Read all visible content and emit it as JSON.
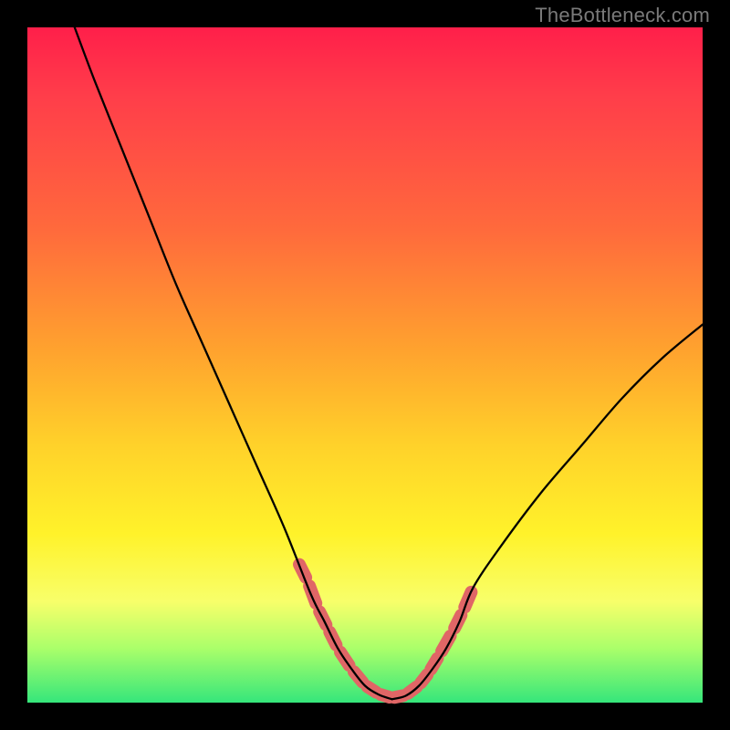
{
  "watermark": "TheBottleneck.com",
  "colors": {
    "frame_bg": "#000000",
    "gradient_top": "#ff1f4a",
    "gradient_bottom": "#35e67b",
    "curve": "#000000",
    "marker": "#e06666"
  },
  "chart_data": {
    "type": "line",
    "title": "",
    "xlabel": "",
    "ylabel": "",
    "xlim": [
      0,
      100
    ],
    "ylim": [
      0,
      100
    ],
    "grid": false,
    "legend": false,
    "annotations": [
      "TheBottleneck.com"
    ],
    "curve_left": {
      "x": [
        7,
        10,
        14,
        18,
        22,
        26,
        30,
        34,
        38,
        42,
        44,
        46,
        48,
        50,
        52,
        54
      ],
      "y": [
        100,
        92,
        82,
        72,
        62,
        53,
        44,
        35,
        26,
        16,
        12,
        8,
        5,
        2.5,
        1.2,
        0.5
      ]
    },
    "curve_right": {
      "x": [
        54,
        56,
        58,
        60,
        62,
        64,
        66,
        70,
        76,
        82,
        88,
        94,
        100
      ],
      "y": [
        0.5,
        1,
        2.5,
        5,
        8,
        12,
        17,
        23,
        31,
        38,
        45,
        51,
        56
      ]
    },
    "markers": {
      "comment": "Pink marker segments along curve near the minimum, as (x,y) pairs on same scale",
      "points": [
        [
          40,
          21
        ],
        [
          41.5,
          18
        ],
        [
          43,
          14
        ],
        [
          44.5,
          11
        ],
        [
          46,
          8
        ],
        [
          48,
          5
        ],
        [
          50,
          2.6
        ],
        [
          52,
          1.3
        ],
        [
          54,
          0.7
        ],
        [
          56,
          1.1
        ],
        [
          58,
          2.6
        ],
        [
          59.5,
          4.5
        ],
        [
          61,
          7
        ],
        [
          63,
          10.5
        ],
        [
          64.5,
          13.5
        ],
        [
          66,
          17
        ]
      ]
    }
  }
}
